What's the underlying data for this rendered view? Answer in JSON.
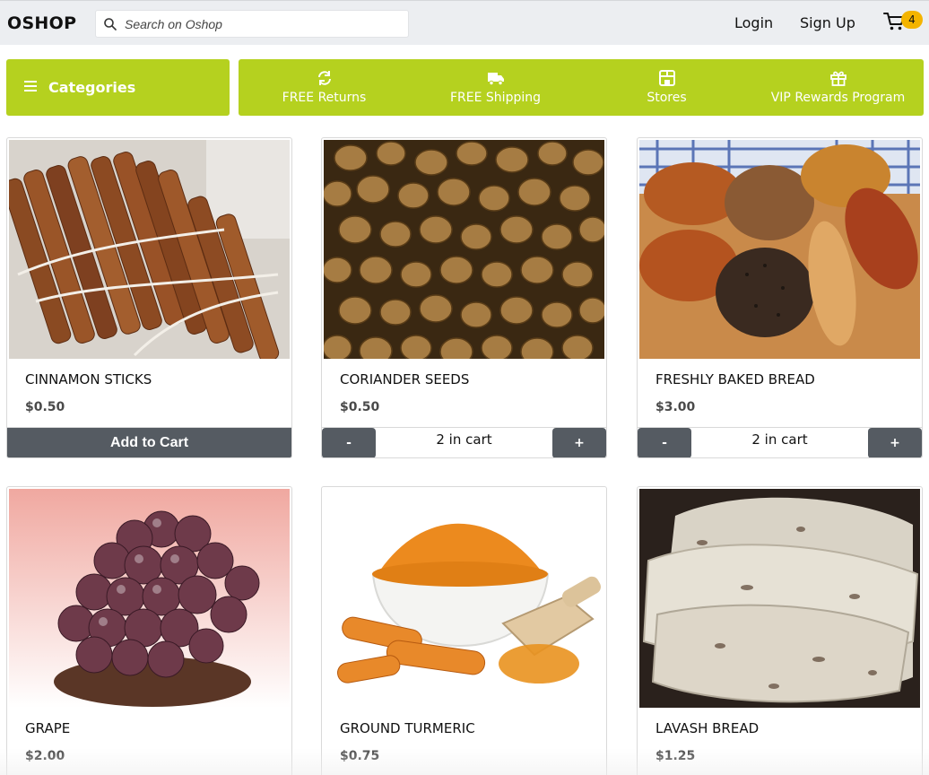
{
  "header": {
    "brand": "OSHOP",
    "search_placeholder": "Search on Oshop",
    "login": "Login",
    "signup": "Sign Up",
    "cart_count": "4"
  },
  "categories": {
    "label": "Categories"
  },
  "perks": [
    {
      "label": "FREE Returns",
      "icon": "refresh-icon"
    },
    {
      "label": "FREE Shipping",
      "icon": "truck-icon"
    },
    {
      "label": "Stores",
      "icon": "store-icon"
    },
    {
      "label": "VIP Rewards Program",
      "icon": "gift-icon"
    }
  ],
  "products": [
    {
      "name": "CINNAMON STICKS",
      "price": "$0.50",
      "action": "Add to Cart"
    },
    {
      "name": "CORIANDER SEEDS",
      "price": "$0.50",
      "in_cart": "2 in cart",
      "minus": "-",
      "plus": "+"
    },
    {
      "name": "FRESHLY BAKED BREAD",
      "price": "$3.00",
      "in_cart": "2 in cart",
      "minus": "-",
      "plus": "+"
    },
    {
      "name": "GRAPE",
      "price": "$2.00"
    },
    {
      "name": "GROUND TURMERIC",
      "price": "$0.75"
    },
    {
      "name": "LAVASH BREAD",
      "price": "$1.25"
    }
  ],
  "colors": {
    "accent": "#b5d11f",
    "button": "#555b62",
    "badge": "#f4b400"
  }
}
